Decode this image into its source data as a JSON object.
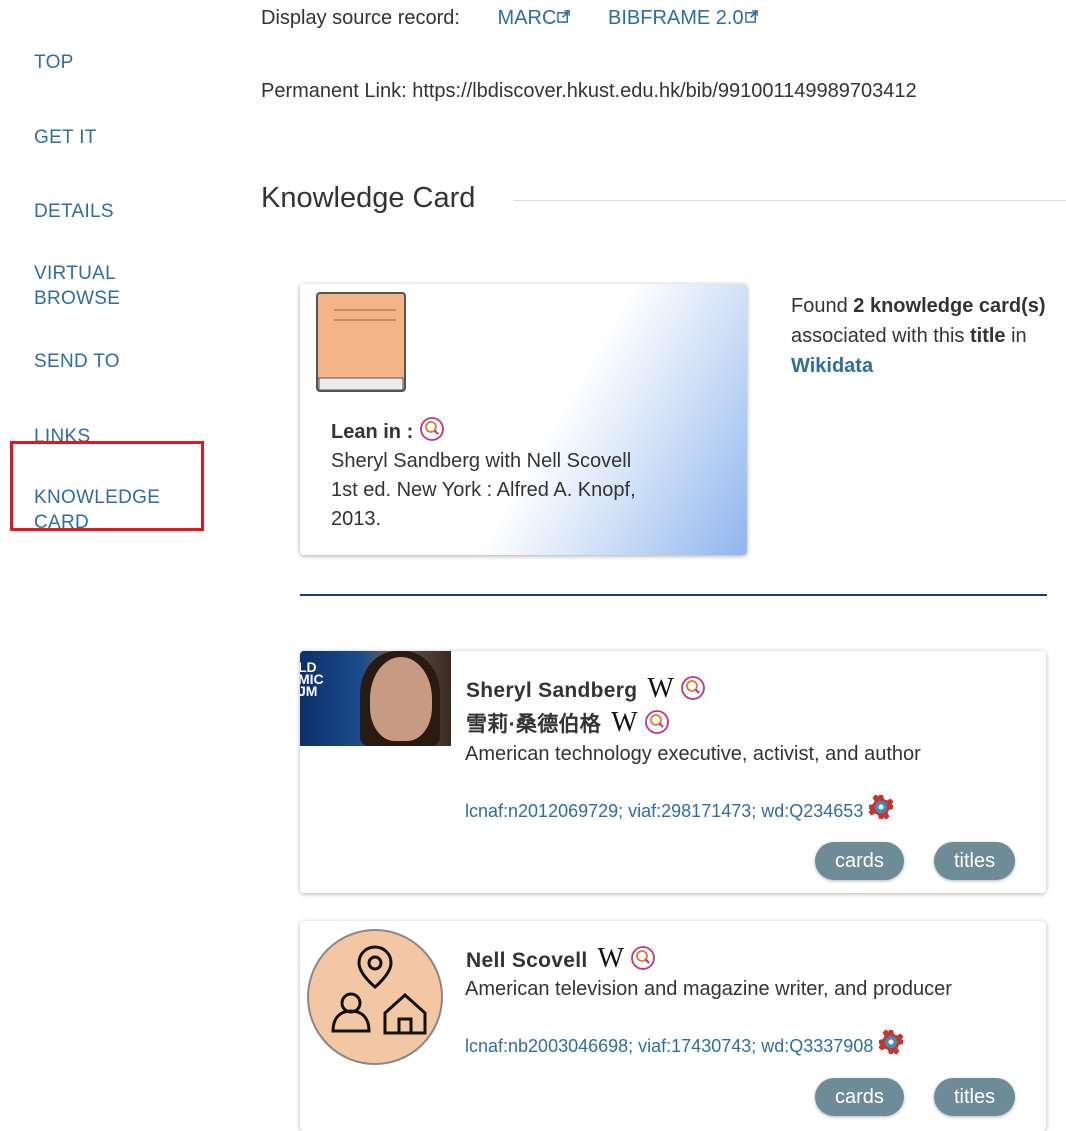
{
  "sidebar": {
    "items": [
      {
        "label": "TOP"
      },
      {
        "label": "GET IT"
      },
      {
        "label": "DETAILS"
      },
      {
        "label": "VIRTUAL BROWSE"
      },
      {
        "label": "SEND TO"
      },
      {
        "label": "LINKS"
      },
      {
        "label": "KNOWLEDGE CARD"
      }
    ]
  },
  "source_record": {
    "label": "Display source record:",
    "links": [
      "MARC",
      "BIBFRAME 2.0"
    ]
  },
  "permanent_link": "Permanent Link: https://lbdiscover.hkust.edu.hk/bib/991001149989703412",
  "knowledge_card": {
    "heading": "Knowledge Card",
    "title_card": {
      "title": "Lean in :",
      "lines": [
        "Sheryl Sandberg with Nell Scovell",
        "1st ed. New York : Alfred A. Knopf,",
        "2013."
      ]
    },
    "found": {
      "prefix": "Found",
      "count": "2 knowledge card(s)",
      "middle": "associated with this",
      "title_word": "title",
      "in": "in",
      "source": "Wikidata"
    }
  },
  "entities": [
    {
      "name": "Sheryl Sandberg",
      "alt_name": "雪莉·桑德伯格",
      "description": "American technology executive, activist, and author",
      "ids": "lcnaf:n2012069729; viaf:298171473; wd:Q234653",
      "buttons": [
        "cards",
        "titles"
      ]
    },
    {
      "name": "Nell Scovell",
      "description": "American television and magazine writer, and producer",
      "ids": "lcnaf:nb2003046698; viaf:17430743; wd:Q3337908",
      "buttons": [
        "cards",
        "titles"
      ]
    }
  ],
  "colors": {
    "accent": "#2f6d9f",
    "highlight": "#e8141c",
    "rule": "#1d3f6e",
    "pill": "#6e8b98"
  }
}
